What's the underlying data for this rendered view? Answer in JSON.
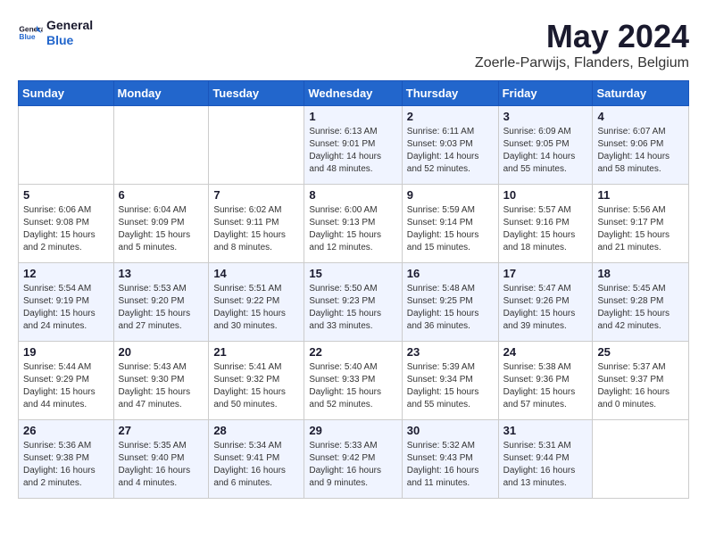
{
  "header": {
    "logo_line1": "General",
    "logo_line2": "Blue",
    "title": "May 2024",
    "subtitle": "Zoerle-Parwijs, Flanders, Belgium"
  },
  "days_of_week": [
    "Sunday",
    "Monday",
    "Tuesday",
    "Wednesday",
    "Thursday",
    "Friday",
    "Saturday"
  ],
  "weeks": [
    {
      "days": [
        {
          "num": "",
          "info": ""
        },
        {
          "num": "",
          "info": ""
        },
        {
          "num": "",
          "info": ""
        },
        {
          "num": "1",
          "info": "Sunrise: 6:13 AM\nSunset: 9:01 PM\nDaylight: 14 hours\nand 48 minutes."
        },
        {
          "num": "2",
          "info": "Sunrise: 6:11 AM\nSunset: 9:03 PM\nDaylight: 14 hours\nand 52 minutes."
        },
        {
          "num": "3",
          "info": "Sunrise: 6:09 AM\nSunset: 9:05 PM\nDaylight: 14 hours\nand 55 minutes."
        },
        {
          "num": "4",
          "info": "Sunrise: 6:07 AM\nSunset: 9:06 PM\nDaylight: 14 hours\nand 58 minutes."
        }
      ]
    },
    {
      "days": [
        {
          "num": "5",
          "info": "Sunrise: 6:06 AM\nSunset: 9:08 PM\nDaylight: 15 hours\nand 2 minutes."
        },
        {
          "num": "6",
          "info": "Sunrise: 6:04 AM\nSunset: 9:09 PM\nDaylight: 15 hours\nand 5 minutes."
        },
        {
          "num": "7",
          "info": "Sunrise: 6:02 AM\nSunset: 9:11 PM\nDaylight: 15 hours\nand 8 minutes."
        },
        {
          "num": "8",
          "info": "Sunrise: 6:00 AM\nSunset: 9:13 PM\nDaylight: 15 hours\nand 12 minutes."
        },
        {
          "num": "9",
          "info": "Sunrise: 5:59 AM\nSunset: 9:14 PM\nDaylight: 15 hours\nand 15 minutes."
        },
        {
          "num": "10",
          "info": "Sunrise: 5:57 AM\nSunset: 9:16 PM\nDaylight: 15 hours\nand 18 minutes."
        },
        {
          "num": "11",
          "info": "Sunrise: 5:56 AM\nSunset: 9:17 PM\nDaylight: 15 hours\nand 21 minutes."
        }
      ]
    },
    {
      "days": [
        {
          "num": "12",
          "info": "Sunrise: 5:54 AM\nSunset: 9:19 PM\nDaylight: 15 hours\nand 24 minutes."
        },
        {
          "num": "13",
          "info": "Sunrise: 5:53 AM\nSunset: 9:20 PM\nDaylight: 15 hours\nand 27 minutes."
        },
        {
          "num": "14",
          "info": "Sunrise: 5:51 AM\nSunset: 9:22 PM\nDaylight: 15 hours\nand 30 minutes."
        },
        {
          "num": "15",
          "info": "Sunrise: 5:50 AM\nSunset: 9:23 PM\nDaylight: 15 hours\nand 33 minutes."
        },
        {
          "num": "16",
          "info": "Sunrise: 5:48 AM\nSunset: 9:25 PM\nDaylight: 15 hours\nand 36 minutes."
        },
        {
          "num": "17",
          "info": "Sunrise: 5:47 AM\nSunset: 9:26 PM\nDaylight: 15 hours\nand 39 minutes."
        },
        {
          "num": "18",
          "info": "Sunrise: 5:45 AM\nSunset: 9:28 PM\nDaylight: 15 hours\nand 42 minutes."
        }
      ]
    },
    {
      "days": [
        {
          "num": "19",
          "info": "Sunrise: 5:44 AM\nSunset: 9:29 PM\nDaylight: 15 hours\nand 44 minutes."
        },
        {
          "num": "20",
          "info": "Sunrise: 5:43 AM\nSunset: 9:30 PM\nDaylight: 15 hours\nand 47 minutes."
        },
        {
          "num": "21",
          "info": "Sunrise: 5:41 AM\nSunset: 9:32 PM\nDaylight: 15 hours\nand 50 minutes."
        },
        {
          "num": "22",
          "info": "Sunrise: 5:40 AM\nSunset: 9:33 PM\nDaylight: 15 hours\nand 52 minutes."
        },
        {
          "num": "23",
          "info": "Sunrise: 5:39 AM\nSunset: 9:34 PM\nDaylight: 15 hours\nand 55 minutes."
        },
        {
          "num": "24",
          "info": "Sunrise: 5:38 AM\nSunset: 9:36 PM\nDaylight: 15 hours\nand 57 minutes."
        },
        {
          "num": "25",
          "info": "Sunrise: 5:37 AM\nSunset: 9:37 PM\nDaylight: 16 hours\nand 0 minutes."
        }
      ]
    },
    {
      "days": [
        {
          "num": "26",
          "info": "Sunrise: 5:36 AM\nSunset: 9:38 PM\nDaylight: 16 hours\nand 2 minutes."
        },
        {
          "num": "27",
          "info": "Sunrise: 5:35 AM\nSunset: 9:40 PM\nDaylight: 16 hours\nand 4 minutes."
        },
        {
          "num": "28",
          "info": "Sunrise: 5:34 AM\nSunset: 9:41 PM\nDaylight: 16 hours\nand 6 minutes."
        },
        {
          "num": "29",
          "info": "Sunrise: 5:33 AM\nSunset: 9:42 PM\nDaylight: 16 hours\nand 9 minutes."
        },
        {
          "num": "30",
          "info": "Sunrise: 5:32 AM\nSunset: 9:43 PM\nDaylight: 16 hours\nand 11 minutes."
        },
        {
          "num": "31",
          "info": "Sunrise: 5:31 AM\nSunset: 9:44 PM\nDaylight: 16 hours\nand 13 minutes."
        },
        {
          "num": "",
          "info": ""
        }
      ]
    }
  ]
}
